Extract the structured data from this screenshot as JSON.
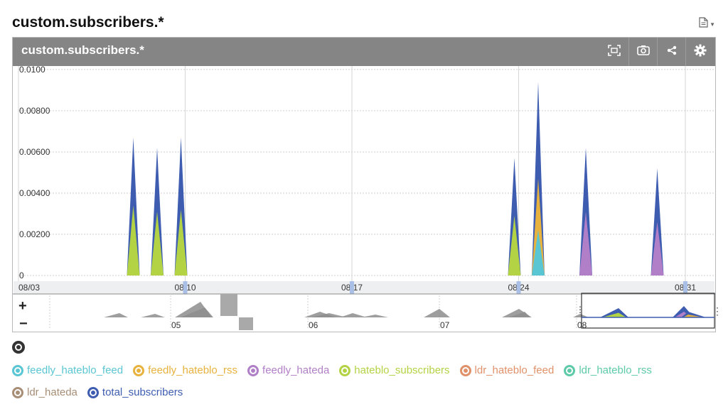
{
  "page": {
    "title": "custom.subscribers.*"
  },
  "header_icons": [
    "document-icon",
    "chevron-down-icon"
  ],
  "panel": {
    "title": "custom.subscribers.*",
    "buttons": [
      "expand-icon",
      "camera-icon",
      "share-icon",
      "gear-icon"
    ]
  },
  "chart_data": {
    "type": "area",
    "stacked": true,
    "title": "custom.subscribers.*",
    "xlabel": "",
    "ylabel": "",
    "x_ticks": [
      "08/03",
      "08/10",
      "08/17",
      "08/24",
      "08/31"
    ],
    "y_ticks": [
      "0",
      "0.00200",
      "0.00400",
      "0.00600",
      "0.00800",
      "0.0100"
    ],
    "ylim": [
      0,
      0.0101
    ],
    "grid": true,
    "series_colors": {
      "feedly_hateblo_feed": "#5bc6d3",
      "feedly_hateblo_rss": "#e7b23d",
      "feedly_hateda": "#b17fc7",
      "hateblo_subscribers": "#b3d345",
      "ldr_hateblo_feed": "#e0916a",
      "ldr_hateblo_rss": "#5dcaa8",
      "ldr_hateda": "#a88e76",
      "total_subscribers": "#3e5db0"
    },
    "spikes": [
      {
        "date": "08/08",
        "hateblo_subscribers": 0.0034,
        "total_subscribers": 0.0067
      },
      {
        "date": "08/09",
        "hateblo_subscribers": 0.0031,
        "total_subscribers": 0.0062
      },
      {
        "date": "08/10",
        "hateblo_subscribers": 0.0032,
        "total_subscribers": 0.0067
      },
      {
        "date": "08/24",
        "hateblo_subscribers": 0.0029,
        "total_subscribers": 0.0057
      },
      {
        "date": "08/25",
        "feedly_hateblo_feed": 0.0022,
        "feedly_hateblo_rss": 0.0047,
        "total_subscribers": 0.0094
      },
      {
        "date": "08/27",
        "feedly_hateda": 0.0031,
        "total_subscribers": 0.0062
      },
      {
        "date": "08/30",
        "feedly_hateda": 0.0026,
        "total_subscribers": 0.0052
      }
    ],
    "navigator": {
      "month_labels": [
        "05",
        "06",
        "07",
        "08"
      ],
      "zoom_in_label": "+",
      "zoom_out_label": "−"
    }
  },
  "legend": {
    "toggle_icon": "toggle-all-icon",
    "items": [
      {
        "label": "feedly_hateblo_feed",
        "color": "#5bc6d3"
      },
      {
        "label": "feedly_hateblo_rss",
        "color": "#e7b23d"
      },
      {
        "label": "feedly_hateda",
        "color": "#b17fc7"
      },
      {
        "label": "hateblo_subscribers",
        "color": "#b3d345"
      },
      {
        "label": "ldr_hateblo_feed",
        "color": "#e0916a"
      },
      {
        "label": "ldr_hateblo_rss",
        "color": "#5dcaa8"
      },
      {
        "label": "ldr_hateda",
        "color": "#a88e76"
      },
      {
        "label": "total_subscribers",
        "color": "#3e5db0"
      }
    ]
  }
}
